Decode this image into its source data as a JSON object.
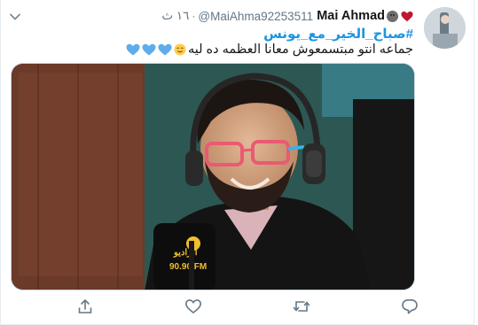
{
  "tweet": {
    "author": {
      "name": "Mai Ahmad",
      "handle": "@MaiAhma92253511",
      "name_emoji_icons": [
        "neutral-face-icon",
        "red-heart-icon"
      ]
    },
    "time": "١٦ ث",
    "hashtag": "#صباح_الخير_مع_يونس",
    "text": "جماعه انتو مبتسمعوش معانا العظمه ده ليه",
    "text_emoji_icons": [
      "relieved-face-icon",
      "blue-heart-icon",
      "blue-heart-icon",
      "blue-heart-icon"
    ],
    "media": {
      "mic_logo_text": "الراديو",
      "mic_freq_text": "90.90 FM"
    },
    "actions": [
      "share-icon",
      "like-icon",
      "retweet-icon",
      "reply-icon"
    ]
  },
  "colors": {
    "hashtag": "#1b95e0",
    "name": "#14171a",
    "meta": "#657786",
    "blue_heart": "#5dadec",
    "red_heart": "#be1931"
  }
}
